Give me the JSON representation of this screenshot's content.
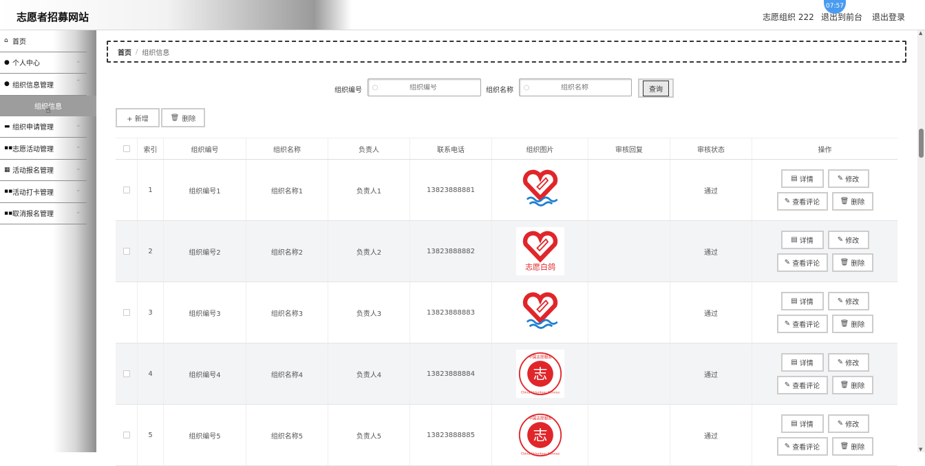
{
  "header": {
    "title": "志愿者招募网站",
    "user": "志愿组织 222",
    "front": "退出到前台",
    "logout": "退出登录",
    "clock": "07:57"
  },
  "sidebar": {
    "items": [
      {
        "label": "首页",
        "icon": "home-icon"
      },
      {
        "label": "个人中心",
        "icon": "user-icon"
      },
      {
        "label": "组织信息管理",
        "icon": "user-icon"
      },
      {
        "label": "组织申请管理",
        "icon": "chat-icon"
      },
      {
        "label": "志愿活动管理",
        "icon": "grid-icon"
      },
      {
        "label": "活动报名管理",
        "icon": "table-icon"
      },
      {
        "label": "活动打卡管理",
        "icon": "grid-icon"
      },
      {
        "label": "取消报名管理",
        "icon": "grid-icon"
      }
    ],
    "active_sub": "组织信息"
  },
  "breadcrumb": {
    "home": "首页",
    "sep": "/",
    "current": "组织信息"
  },
  "search": {
    "label1": "组织编号",
    "placeholder1": "组织编号",
    "label2": "组织名称",
    "placeholder2": "组织名称",
    "button": "查询"
  },
  "actions": {
    "add": "+ 新增",
    "delete": "删除"
  },
  "table": {
    "headers": [
      "索引",
      "组织编号",
      "组织名称",
      "负责人",
      "联系电话",
      "组织图片",
      "审核回复",
      "审核状态",
      "操作"
    ],
    "rows": [
      {
        "index": "1",
        "code": "组织编号1",
        "name": "组织名称1",
        "person": "负责人1",
        "phone": "13823888881",
        "image": "heart-hand-blue",
        "reply": "",
        "status": "通过"
      },
      {
        "index": "2",
        "code": "组织编号2",
        "name": "组织名称2",
        "person": "负责人2",
        "phone": "13823888882",
        "image": "heart-hand-text",
        "reply": "",
        "status": "通过"
      },
      {
        "index": "3",
        "code": "组织编号3",
        "name": "组织名称3",
        "person": "负责人3",
        "phone": "13823888883",
        "image": "heart-hand-blue",
        "reply": "",
        "status": "通过"
      },
      {
        "index": "4",
        "code": "组织编号4",
        "name": "组织名称4",
        "person": "负责人4",
        "phone": "13823888884",
        "image": "china-volunteer-seal",
        "reply": "",
        "status": "通过"
      },
      {
        "index": "5",
        "code": "组织编号5",
        "name": "组织名称5",
        "person": "负责人5",
        "phone": "13823888885",
        "image": "china-volunteer-seal",
        "reply": "",
        "status": "通过"
      }
    ],
    "ops": {
      "detail": "详情",
      "edit": "修改",
      "comments": "查看评论",
      "delete": "删除"
    }
  },
  "logo_text": {
    "brand": "志愿白鸽",
    "seal_top": "中国志愿服务",
    "seal_bottom": "China Volunteer Service",
    "seal_char": "志"
  },
  "colors": {
    "heart_red": "#e0262a",
    "wave_blue": "#1d7fd1",
    "sidebar_active": "#9d9d9d"
  }
}
